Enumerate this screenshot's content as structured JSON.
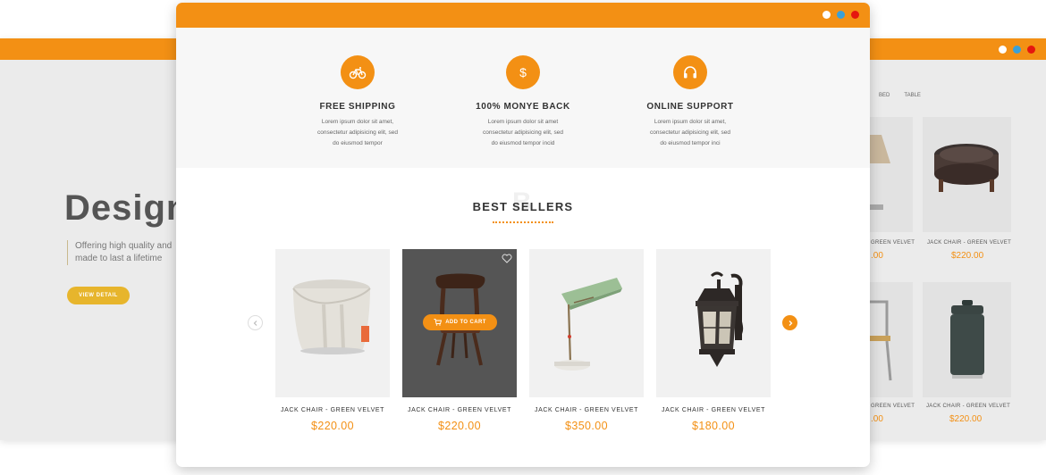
{
  "colors": {
    "accent": "#f39014",
    "window_dots": [
      "#ffffff",
      "#3aa0d8",
      "#e5160f"
    ],
    "hero_button": "#e7b52c"
  },
  "background_window": {
    "hero": {
      "title": "Design",
      "subtitle_lines": [
        "Offering high quality and",
        "made to last a lifetime"
      ],
      "button_label": "VIEW DETAIL"
    },
    "tabs": [
      "BED",
      "TABLE"
    ],
    "products": [
      {
        "name": "GREEN VELVET",
        "price": ".00",
        "image": "lamp-icon"
      },
      {
        "name": "JACK CHAIR - GREEN VELVET",
        "price": "$220.00",
        "image": "ottoman-icon"
      },
      {
        "name": "GREEN VELVET",
        "price": ".00",
        "image": "chair-icon"
      },
      {
        "name": "JACK CHAIR - GREEN VELVET",
        "price": "$220.00",
        "image": "trash-can-icon"
      }
    ]
  },
  "features": [
    {
      "icon": "bicycle-icon",
      "title": "FREE SHIPPING",
      "desc_lines": [
        "Lorem ipsum dolor sit amet,",
        "consectetur adipisicing elit, sed",
        "do eiusmod tempor"
      ]
    },
    {
      "icon": "dollar-icon",
      "title": "100% MONYE BACK",
      "desc_lines": [
        "Lorem ipsum dolor sit amet",
        "consectetur adipisicing elit, sed",
        "do eiusmod tempor incid"
      ]
    },
    {
      "icon": "headphones-icon",
      "title": "ONLINE SUPPORT",
      "desc_lines": [
        "Lorem ipsum dolor sit amet,",
        "consectetur adipisicing elit, sed",
        "do eiusmod tempor inci"
      ]
    }
  ],
  "best_sellers": {
    "title": "BEST SELLERS",
    "watermark": "B",
    "add_to_cart_label": "ADD TO CART",
    "products": [
      {
        "name": "JACK CHAIR - GREEN VELVET",
        "price": "$220.00",
        "image": "fabric-basket-icon"
      },
      {
        "name": "JACK CHAIR - GREEN VELVET",
        "price": "$220.00",
        "image": "wooden-chair-icon"
      },
      {
        "name": "JACK CHAIR - GREEN VELVET",
        "price": "$350.00",
        "image": "desk-lamp-icon"
      },
      {
        "name": "JACK CHAIR - GREEN VELVET",
        "price": "$180.00",
        "image": "wall-lantern-icon"
      }
    ]
  }
}
